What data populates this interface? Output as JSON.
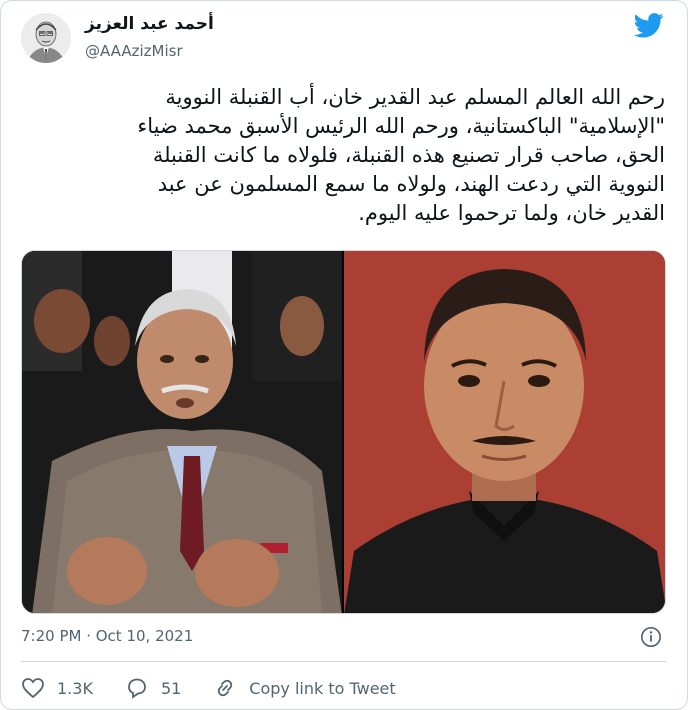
{
  "author": {
    "display_name": "أحمد عبد العزيز",
    "handle": "@AAAzizMisr"
  },
  "tweet": {
    "lines": [
      "رحم الله العالم المسلم عبد القدير خان، أب القنبلة النووية",
      "\"الإسلامية\" الباكستانية، ورحم الله الرئيس الأسبق محمد ضياء",
      "الحق، صاحب قرار تصنيع هذه القنبلة، فلولاه ما كانت القنبلة",
      "النووية التي ردعت الهند، ولولاه ما سمع المسلمون عن عبد",
      "القدير خان، ولما ترحموا عليه اليوم."
    ],
    "timestamp": "7:20 PM · Oct 10, 2021"
  },
  "actions": {
    "likes": "1.3K",
    "replies": "51",
    "copy_link": "Copy link to Tweet"
  },
  "icons": {
    "brand": "twitter-bird-icon",
    "info": "info-icon",
    "like": "heart-icon",
    "reply": "comment-icon",
    "copy": "link-icon"
  },
  "colors": {
    "brand": "#1d9bf0",
    "secondary_text": "#536471",
    "border": "#cfd9de"
  }
}
